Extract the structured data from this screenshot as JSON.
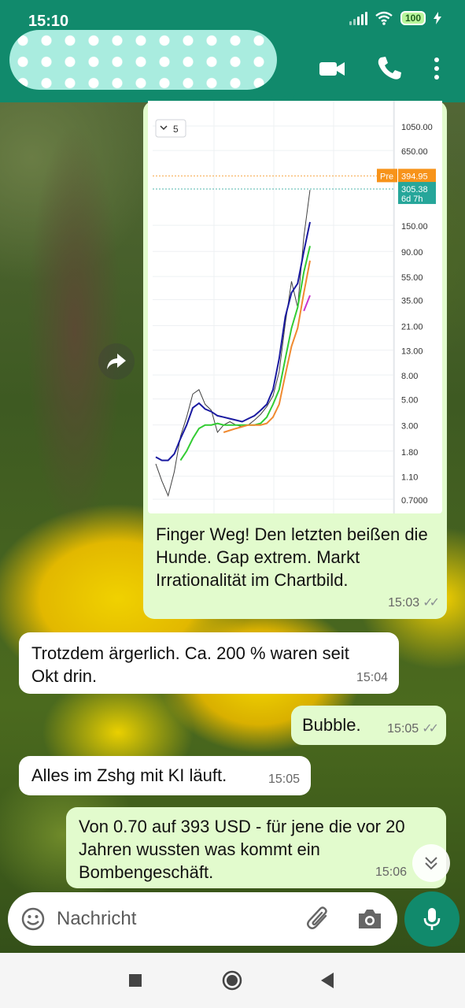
{
  "status_bar": {
    "time": "15:10",
    "battery": "100"
  },
  "header": {
    "contact_name_redacted": true
  },
  "messages": [
    {
      "kind": "chart",
      "direction": "outgoing",
      "text": "Finger Weg! Den letzten beißen die Hunde. Gap extrem. Markt Irrationalität im Chartbild.",
      "time": "15:03"
    },
    {
      "direction": "incoming",
      "text": "Trotzdem ärgerlich. Ca. 200 % waren seit Okt drin.",
      "time": "15:04"
    },
    {
      "direction": "outgoing",
      "text": "Bubble.",
      "time": "15:05"
    },
    {
      "direction": "incoming",
      "text": "Alles im Zshg mit KI läuft.",
      "time": "15:05"
    },
    {
      "direction": "outgoing",
      "text": "Von 0.70 auf 393 USD - für jene die vor 20 Jahren wussten was kommt ein Bombengeschäft.",
      "time": "15:06"
    }
  ],
  "input": {
    "placeholder": "Nachricht"
  },
  "chart_data": {
    "type": "line",
    "scale": "log",
    "interval_label": "5",
    "y_tick_labels": [
      "1050.00",
      "650.00",
      "150.00",
      "90.00",
      "55.00",
      "35.00",
      "21.00",
      "13.00",
      "8.00",
      "5.00",
      "3.00",
      "1.80",
      "1.10",
      "0.7000"
    ],
    "y_ticks": [
      1050,
      650,
      150,
      90,
      55,
      35,
      21,
      13,
      8,
      5,
      3,
      1.8,
      1.1,
      0.7
    ],
    "price_tags": [
      {
        "label": "Pre",
        "value_label": "394.95",
        "value": 394.95,
        "color": "#f7931a"
      },
      {
        "value_label": "305.38",
        "sub_label": "6d 7h",
        "value": 305.38,
        "color": "#26a69a"
      }
    ],
    "x": [
      0,
      4,
      8,
      12,
      16,
      20,
      24,
      28,
      32,
      36,
      40,
      44,
      48,
      52,
      56,
      60,
      64,
      68,
      72,
      76,
      80,
      84,
      88,
      92,
      96,
      100
    ],
    "series": [
      {
        "color": "#111111",
        "values": [
          1.4,
          1.0,
          0.75,
          1.2,
          2.4,
          3.5,
          5.5,
          6.0,
          4.5,
          4.0,
          2.6,
          3.0,
          3.2,
          3.0,
          2.9,
          3.0,
          3.3,
          3.7,
          4.3,
          5.3,
          8.5,
          22,
          50,
          30,
          120,
          300
        ]
      },
      {
        "color": "#1a1aa0",
        "values": [
          1.6,
          1.5,
          1.5,
          1.7,
          2.3,
          3.0,
          4.2,
          4.6,
          4.1,
          3.9,
          3.6,
          3.5,
          3.4,
          3.3,
          3.2,
          3.4,
          3.6,
          4.0,
          4.5,
          6.0,
          11,
          25,
          40,
          48,
          90,
          160
        ]
      },
      {
        "color": "#33cc33",
        "values": [
          null,
          null,
          null,
          null,
          1.5,
          1.8,
          2.3,
          2.8,
          3.0,
          3.0,
          3.1,
          3.0,
          3.0,
          3.0,
          3.0,
          3.0,
          3.0,
          3.1,
          3.5,
          4.5,
          6.0,
          11,
          20,
          30,
          60,
          100
        ]
      },
      {
        "color": "#f08a30",
        "values": [
          null,
          null,
          null,
          null,
          null,
          null,
          null,
          null,
          null,
          null,
          null,
          2.6,
          2.7,
          2.8,
          2.9,
          3.0,
          3.0,
          3.0,
          3.1,
          3.5,
          4.5,
          8.0,
          14,
          20,
          40,
          75
        ]
      },
      {
        "color": "#cc33cc",
        "values": [
          null,
          null,
          null,
          null,
          null,
          null,
          null,
          null,
          null,
          null,
          null,
          null,
          null,
          null,
          null,
          null,
          null,
          null,
          null,
          null,
          null,
          null,
          null,
          null,
          28,
          38
        ]
      }
    ]
  }
}
